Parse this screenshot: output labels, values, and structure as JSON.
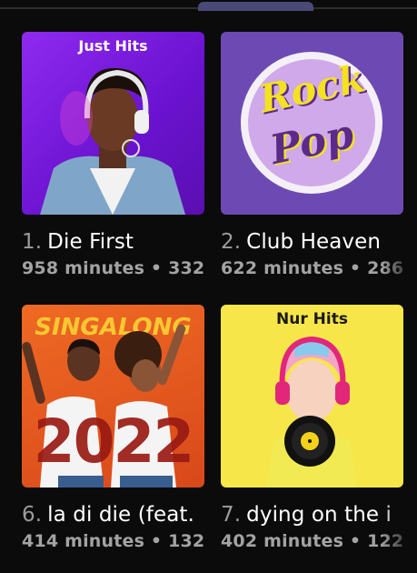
{
  "playlists": [
    {
      "number": "1.",
      "title": "Die First",
      "meta": "958 minutes • 332",
      "cover_label": "Just Hits",
      "colors": {
        "background": "#7a1ee0",
        "accent": "#e44bd6"
      }
    },
    {
      "number": "2.",
      "title": "Club Heaven",
      "meta": "622 minutes • 286",
      "cover_label_line1": "Rock",
      "cover_label_line2": "Pop",
      "colors": {
        "background": "#6d4ab3",
        "accent": "#f4e21f"
      }
    },
    {
      "number": "6.",
      "title": "la di die (feat.",
      "meta": "414 minutes • 132",
      "cover_label": "SINGALONG",
      "cover_year": "2022",
      "colors": {
        "background": "#e4571a",
        "accent": "#f7c832"
      }
    },
    {
      "number": "7.",
      "title": "dying on the i",
      "meta": "402 minutes • 122",
      "cover_label": "Nur Hits",
      "colors": {
        "background": "#f7e64a",
        "accent": "#1a1a1a"
      }
    }
  ]
}
